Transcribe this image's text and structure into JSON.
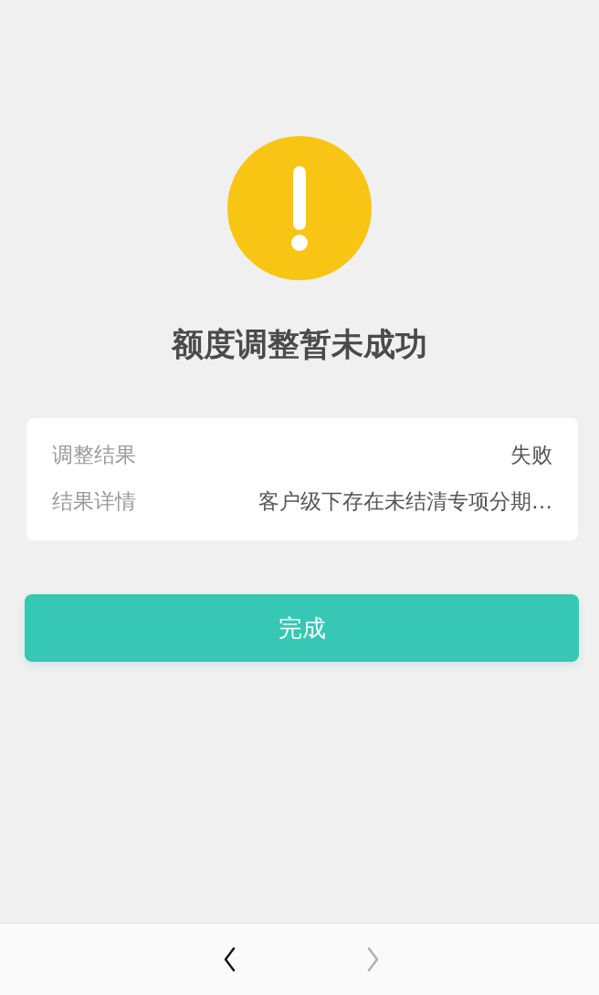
{
  "title": "额度调整暂未成功",
  "result_card": {
    "rows": [
      {
        "label": "调整结果",
        "value": "失败"
      },
      {
        "label": "结果详情",
        "value": "客户级下存在未结清专项分期…"
      }
    ]
  },
  "done_button": {
    "label": "完成"
  },
  "nav_bar": {
    "buttons": [
      {
        "kind": "back",
        "disabled": false
      },
      {
        "kind": "forward",
        "disabled": true
      }
    ]
  }
}
